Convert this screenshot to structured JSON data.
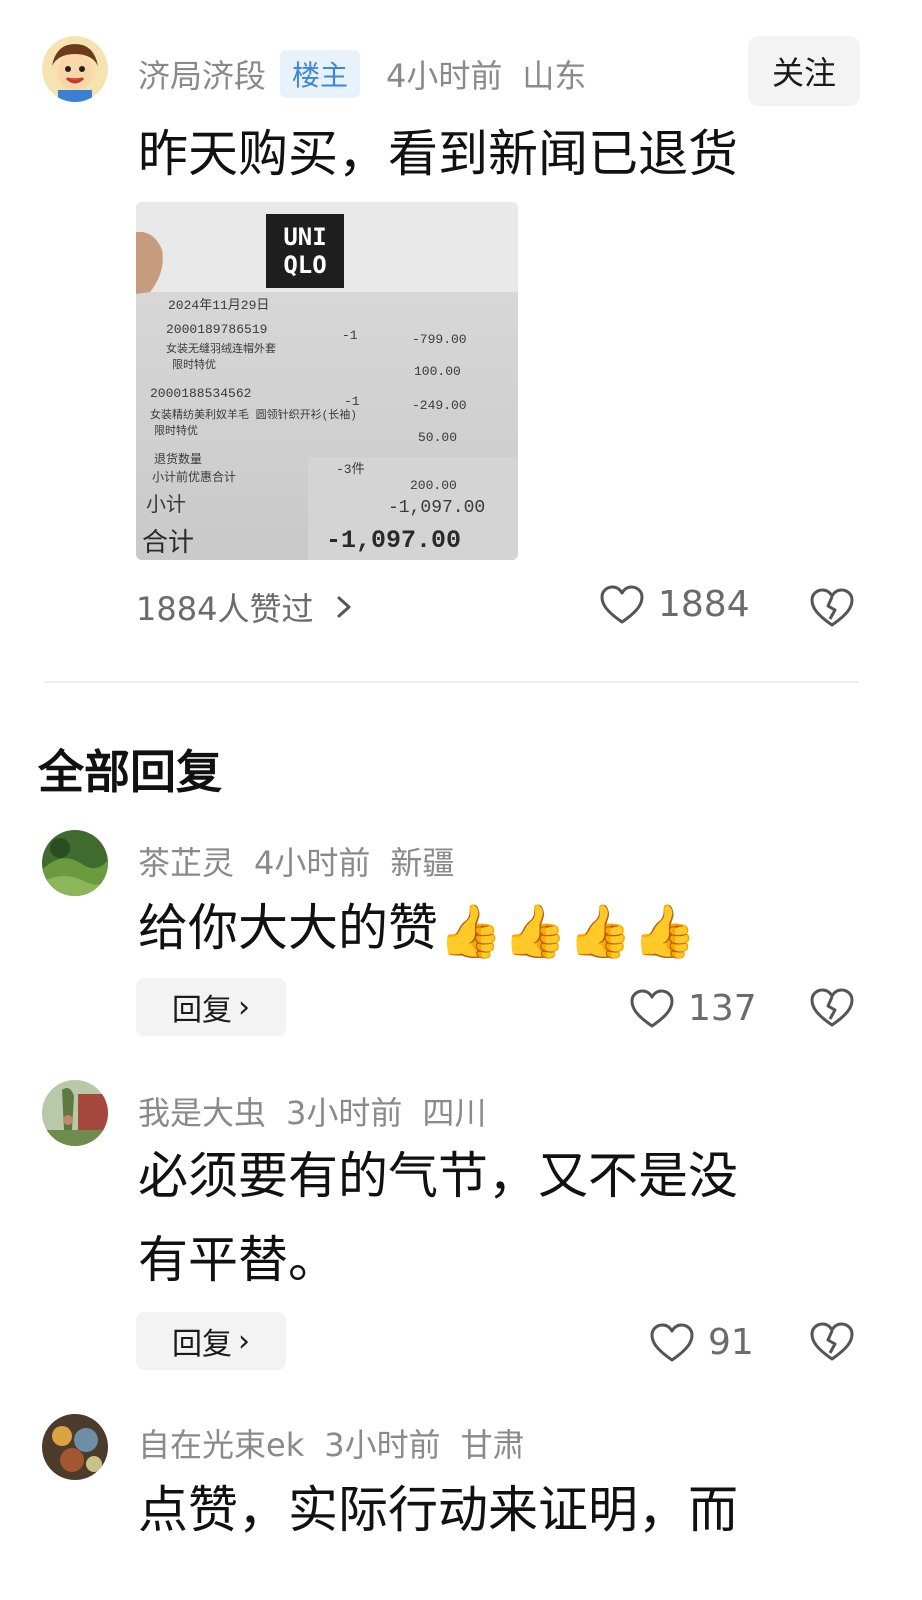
{
  "post": {
    "author": "济局济段",
    "badge": "楼主",
    "time": "4小时前",
    "location": "山东",
    "follow_label": "关注",
    "text": "昨天购买，看到新闻已退货",
    "receipt": {
      "brand_line1": "UNI",
      "brand_line2": "QLO",
      "date": "2024年11月29日",
      "item1_code": "2000189786519",
      "item1_desc": "女装无缝羽绒连帽外套",
      "item1_promo": "限时特优",
      "item1_qty": "-1",
      "item1_price": "-799.00",
      "item1_discount": "100.00",
      "item2_code": "2000188534562",
      "item2_desc": "女装精纺美利奴羊毛 圆领针织开衫(长袖)",
      "item2_promo": "限时特优",
      "item2_qty": "-1",
      "item2_price": "-249.00",
      "item2_discount": "50.00",
      "return_count_label": "退货数量",
      "return_count": "-3件",
      "pre_discount_label": "小计前优惠合计",
      "pre_discount": "200.00",
      "subtotal_label": "小计",
      "subtotal": "-1,097.00",
      "total_label": "合计",
      "total": "-1,097.00"
    },
    "likes_summary": "1884人赞过",
    "like_count": "1884"
  },
  "section_title": "全部回复",
  "replies": [
    {
      "author": "茶芷灵",
      "time": "4小时前",
      "location": "新疆",
      "text": "给你大大的赞",
      "thumbs": [
        "👍",
        "👍",
        "👍",
        "👍"
      ],
      "reply_label": "回复",
      "like_count": "137"
    },
    {
      "author": "我是大虫",
      "time": "3小时前",
      "location": "四川",
      "text_line1": "必须要有的气节，又不是没",
      "text_line2": "有平替。",
      "reply_label": "回复",
      "like_count": "91"
    },
    {
      "author": "自在光束ek",
      "time": "3小时前",
      "location": "甘肃",
      "text_line1": "点赞，实际行动来证明，而"
    }
  ],
  "colors": {
    "meta_gray": "#8a8a8a",
    "badge_bg": "#e8f2fc",
    "badge_text": "#3e86d6",
    "button_bg": "#f3f3f3"
  },
  "icons": [
    "heart-outline-icon",
    "broken-heart-icon",
    "chevron-right-icon",
    "thumbs-up-emoji"
  ]
}
